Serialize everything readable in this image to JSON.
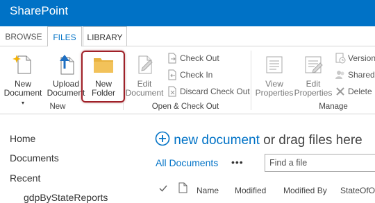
{
  "app": {
    "title": "SharePoint"
  },
  "tabs": [
    {
      "label": "BROWSE"
    },
    {
      "label": "FILES"
    },
    {
      "label": "LIBRARY"
    }
  ],
  "ribbon": {
    "new_group": {
      "label": "New",
      "new_document": {
        "line1": "New",
        "line2": "Document"
      },
      "upload_document": {
        "line1": "Upload",
        "line2": "Document"
      },
      "new_folder": {
        "line1": "New",
        "line2": "Folder"
      }
    },
    "open_checkout_group": {
      "label": "Open & Check Out",
      "edit_document": {
        "line1": "Edit",
        "line2": "Document"
      },
      "check_out": "Check Out",
      "check_in": "Check In",
      "discard_check_out": "Discard Check Out"
    },
    "manage_group": {
      "label": "Manage",
      "view_properties": {
        "line1": "View",
        "line2": "Properties"
      },
      "edit_properties": {
        "line1": "Edit",
        "line2": "Properties"
      },
      "version_history": "Version",
      "shared_with": "Shared",
      "delete_document": "Delete I"
    }
  },
  "leftnav": {
    "items": [
      {
        "label": "Home"
      },
      {
        "label": "Documents"
      },
      {
        "label": "Recent"
      },
      {
        "label": "gdpByStateReports"
      }
    ]
  },
  "main": {
    "new_document_link": "new document",
    "drag_text": " or drag files here",
    "view_name": "All Documents",
    "more": "•••",
    "find_placeholder": "Find a file",
    "columns": [
      "Name",
      "Modified",
      "Modified By",
      "StateOfO"
    ]
  },
  "colors": {
    "brand": "#0072c6",
    "highlight": "#a02028",
    "folder": "#f2c25a"
  }
}
